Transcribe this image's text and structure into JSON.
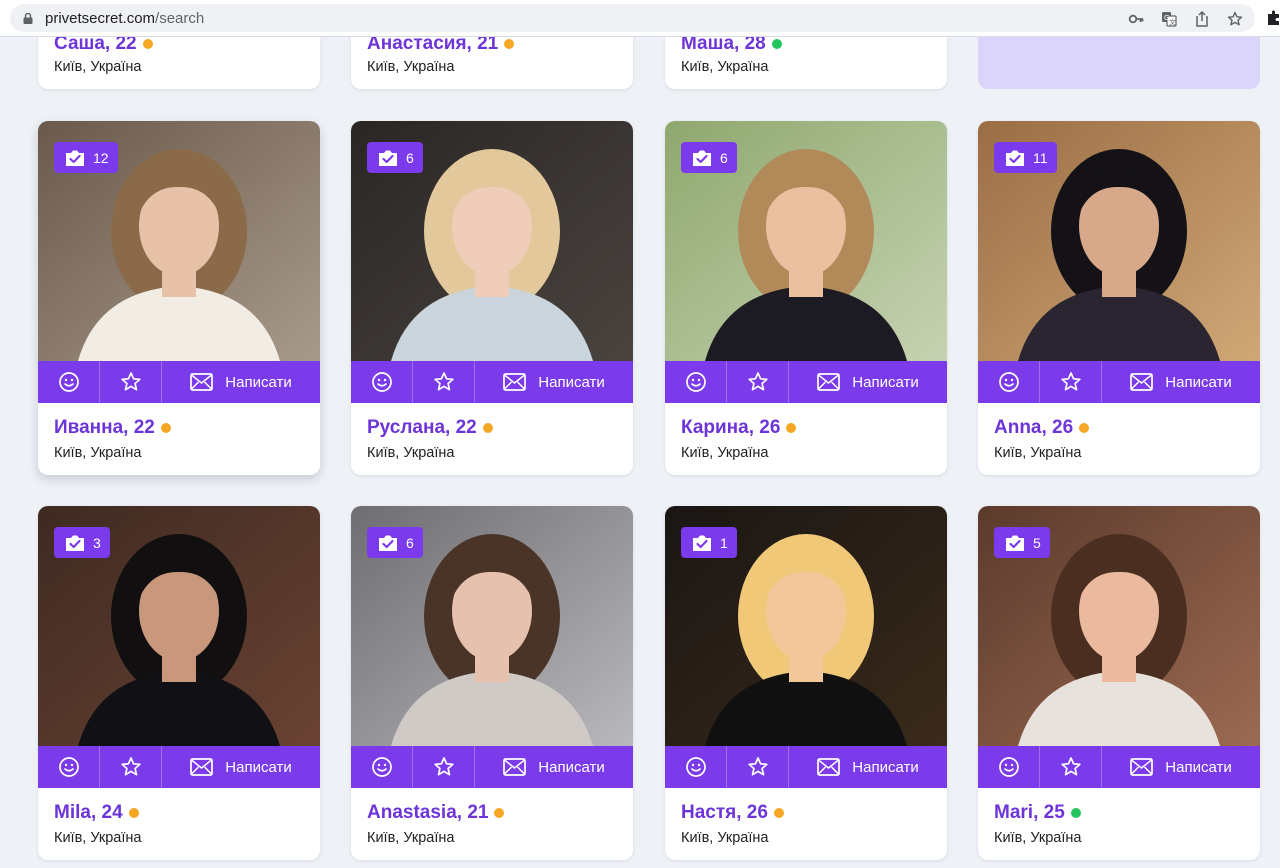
{
  "browser": {
    "url_host": "privetsecret.com",
    "url_path": "/search"
  },
  "colors": {
    "brand_purple": "#7b3bea",
    "status_away": "#f5a623",
    "status_online": "#22c55e"
  },
  "top_row": [
    {
      "name": "Саша, 22",
      "city": "Київ, Україна",
      "status": "away"
    },
    {
      "name": "Анастасия, 21",
      "city": "Київ, Україна",
      "status": "away"
    },
    {
      "name": "Маша, 28",
      "city": "Київ, Україна",
      "status": "online"
    }
  ],
  "actions": {
    "smile_icon": "smile-icon",
    "favorite_icon": "star-icon",
    "write_icon": "envelope-icon",
    "write_label": "Написати"
  },
  "profiles": [
    {
      "name": "Иванна, 22",
      "city": "Київ, Україна",
      "status": "away",
      "photos": "12"
    },
    {
      "name": "Руслана, 22",
      "city": "Київ, Україна",
      "status": "away",
      "photos": "6"
    },
    {
      "name": "Карина, 26",
      "city": "Київ, Україна",
      "status": "away",
      "photos": "6"
    },
    {
      "name": "Anna, 26",
      "city": "Київ, Україна",
      "status": "away",
      "photos": "11"
    },
    {
      "name": "Mila, 24",
      "city": "Київ, Україна",
      "status": "away",
      "photos": "3"
    },
    {
      "name": "Anastasia, 21",
      "city": "Київ, Україна",
      "status": "away",
      "photos": "6"
    },
    {
      "name": "Настя, 26",
      "city": "Київ, Україна",
      "status": "away",
      "photos": "1"
    },
    {
      "name": "Mari, 25",
      "city": "Київ, Україна",
      "status": "online",
      "photos": "5"
    }
  ]
}
